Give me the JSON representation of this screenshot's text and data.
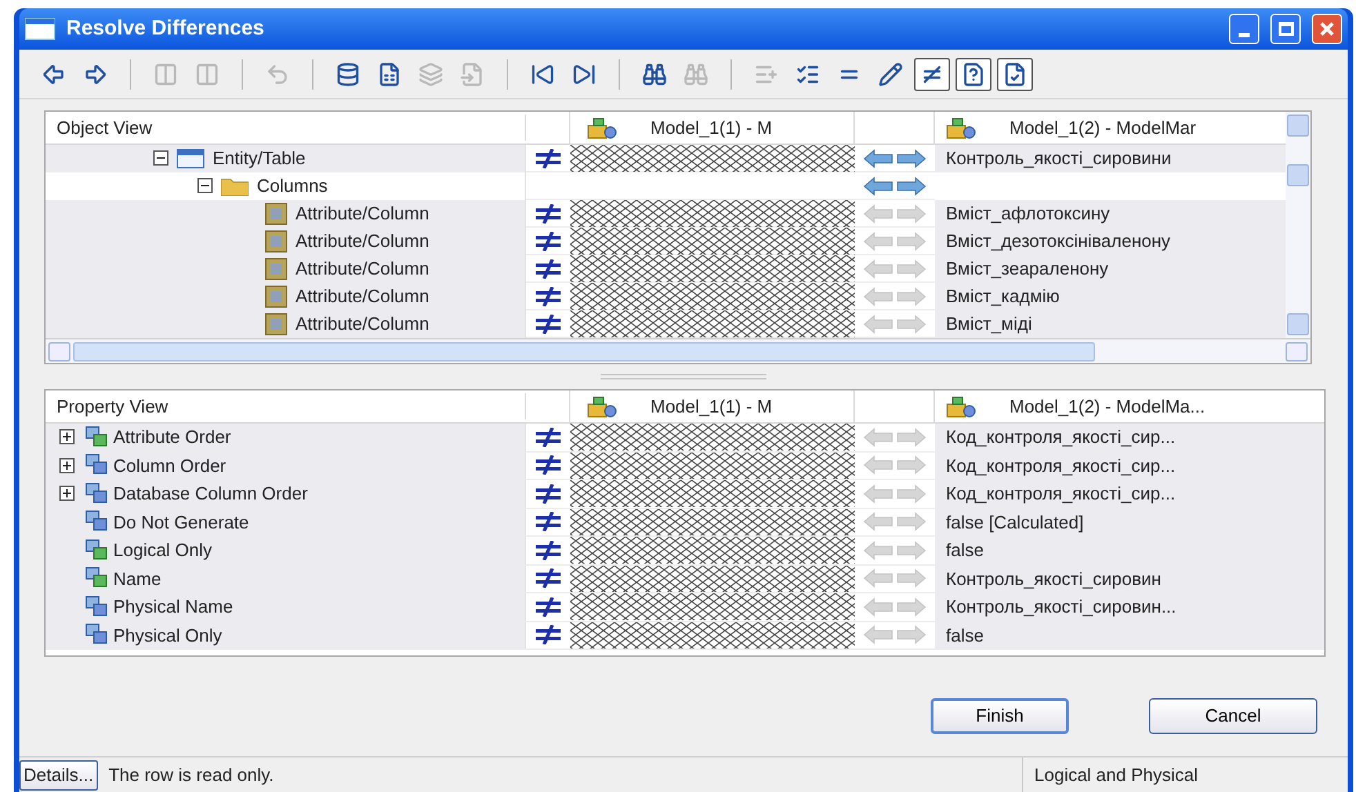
{
  "window": {
    "title": "Resolve Differences"
  },
  "toolbar": [
    [
      {
        "disabled": false,
        "pressed": false
      },
      {
        "disabled": false,
        "pressed": false
      }
    ],
    [
      {
        "disabled": true,
        "pressed": false
      },
      {
        "disabled": true,
        "pressed": false
      }
    ],
    [
      {
        "disabled": true,
        "pressed": false
      }
    ],
    [
      {
        "disabled": false,
        "pressed": false
      },
      {
        "disabled": false,
        "pressed": false
      },
      {
        "disabled": true,
        "pressed": false
      },
      {
        "disabled": true,
        "pressed": false
      }
    ],
    [
      {
        "disabled": false,
        "pressed": false
      },
      {
        "disabled": false,
        "pressed": false
      }
    ],
    [
      {
        "disabled": false,
        "pressed": false
      },
      {
        "disabled": true,
        "pressed": false
      }
    ],
    [
      {
        "disabled": true,
        "pressed": false
      },
      {
        "disabled": false,
        "pressed": false
      },
      {
        "disabled": false,
        "pressed": false
      },
      {
        "disabled": false,
        "pressed": false
      },
      {
        "disabled": false,
        "pressed": true
      },
      {
        "disabled": false,
        "pressed": true
      },
      {
        "disabled": false,
        "pressed": true
      }
    ]
  ],
  "object_view": {
    "columns": [
      "Object View",
      "Model_1(1) - M",
      "Model_1(2) - ModelMar"
    ],
    "rows": [
      {
        "kind": "entity",
        "label": "Entity/Table",
        "expanded": true,
        "different": true,
        "arrows_active": true,
        "right": "Контроль_якості_сировини",
        "children": [
          {
            "kind": "folder",
            "label": "Columns",
            "expanded": true,
            "different": false,
            "arrows_active": true,
            "children": [
              {
                "kind": "attribute",
                "label": "Attribute/Column",
                "different": true,
                "arrows_active": false,
                "right": "Вміст_афлотоксину"
              },
              {
                "kind": "attribute",
                "label": "Attribute/Column",
                "different": true,
                "arrows_active": false,
                "right": "Вміст_дезотоксініваленону"
              },
              {
                "kind": "attribute",
                "label": "Attribute/Column",
                "different": true,
                "arrows_active": false,
                "right": "Вміст_зеараленону"
              },
              {
                "kind": "attribute",
                "label": "Attribute/Column",
                "different": true,
                "arrows_active": false,
                "right": "Вміст_кадмію"
              },
              {
                "kind": "attribute",
                "label": "Attribute/Column",
                "different": true,
                "arrows_active": false,
                "right": "Вміст_міді"
              }
            ]
          }
        ]
      }
    ]
  },
  "property_view": {
    "columns": [
      "Property View",
      "Model_1(1) - M",
      "Model_1(2) - ModelMa..."
    ],
    "rows": [
      {
        "kind": "group",
        "label": "Attribute Order",
        "right": "Код_контроля_якості_сир..."
      },
      {
        "kind": "group",
        "label": "Column Order",
        "right": "Код_контроля_якості_сир..."
      },
      {
        "kind": "group",
        "label": "Database Column Order",
        "right": "Код_контроля_якості_сир..."
      },
      {
        "kind": "property",
        "label": "Do Not Generate",
        "right": "false [Calculated]"
      },
      {
        "kind": "property",
        "label": "Logical Only",
        "right": "false"
      },
      {
        "kind": "property",
        "label": "Name",
        "right": "Контроль_якості_сировин"
      },
      {
        "kind": "property",
        "label": "Physical Name",
        "right": "Контроль_якості_сировин..."
      },
      {
        "kind": "property",
        "label": "Physical Only",
        "right": "false"
      }
    ]
  },
  "buttons": [
    {
      "label": "Finish",
      "default": true
    },
    {
      "label": "Cancel",
      "default": false
    }
  ],
  "status_bar": {
    "details_button": "Details...",
    "message": "The row is read only.",
    "mode": "Logical and Physical"
  }
}
